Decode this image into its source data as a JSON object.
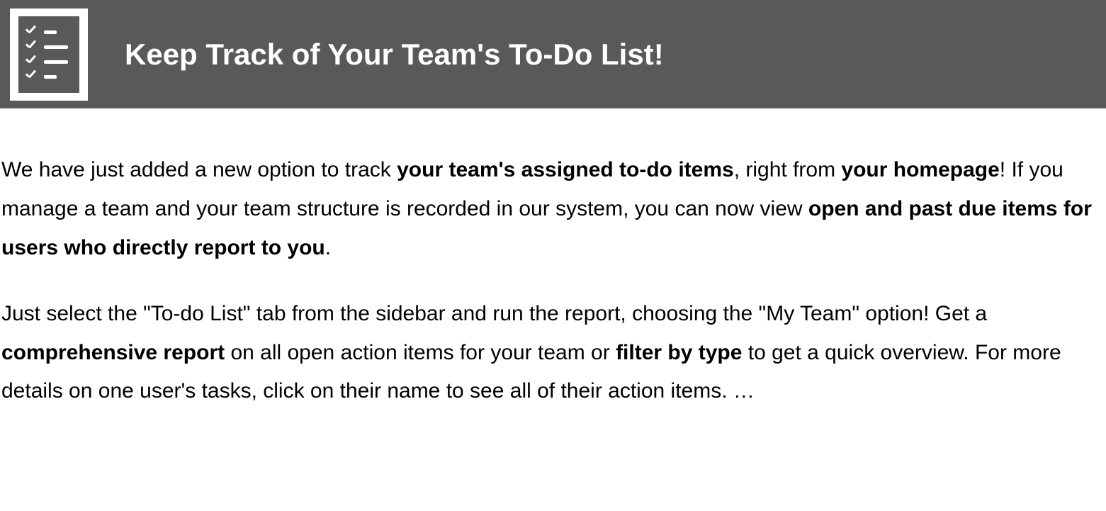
{
  "header": {
    "title": "Keep Track of Your Team's To-Do List!"
  },
  "paragraphs": {
    "p1": {
      "t1": "We have just added a new option to track ",
      "b1": "your team's assigned to-do items",
      "t2": ", right from ",
      "b2": "your homepage",
      "t3": "! If you manage a team and your team structure is recorded in our system, you can now view ",
      "b3": "open and past due items for users who directly report to you",
      "t4": "."
    },
    "p2": {
      "t1": "Just select the \"To-do List\" tab from the sidebar and run the report, choosing the \"My Team\" option! Get a ",
      "b1": "comprehensive report",
      "t2": " on all open action items for your team or ",
      "b2": "filter by type",
      "t3": " to get a quick overview. For more details on one user's tasks, click on their name to see all of their action items. …"
    }
  }
}
